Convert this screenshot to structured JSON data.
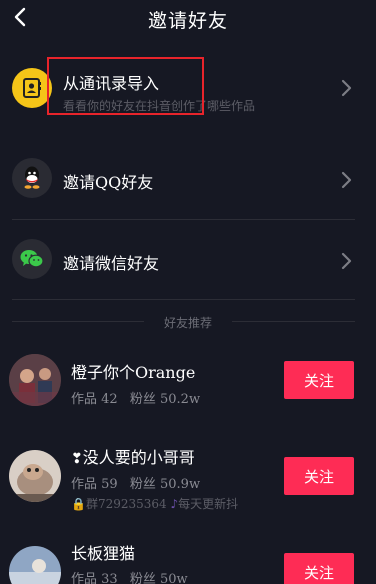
{
  "header": {
    "title": "邀请好友",
    "back_icon": "chevron-left-icon"
  },
  "options": [
    {
      "label": "从通讯录导入",
      "sub": "看看你的好友在抖音创作了哪些作品",
      "icon": "contacts-icon",
      "icon_color": "#f5c518"
    },
    {
      "label": "邀请QQ好友",
      "icon": "qq-icon",
      "icon_color": "#2a2b33"
    },
    {
      "label": "邀请微信好友",
      "icon": "wechat-icon",
      "icon_color": "#2a2b33"
    }
  ],
  "section": {
    "title": "好友推荐"
  },
  "friends": [
    {
      "name": "橙子你个Orange",
      "works_label": "作品",
      "works": "42",
      "fans_label": "粉丝",
      "fans": "50.2w",
      "follow": "关注"
    },
    {
      "name": "没人要的小哥哥",
      "works_label": "作品",
      "works": "59",
      "fans_label": "粉丝",
      "fans": "50.9w",
      "extra_a": "群729235364",
      "extra_b": "每天更新抖",
      "follow": "关注"
    },
    {
      "name": "长板狸猫",
      "works_label": "作品",
      "works": "33",
      "fans_label": "粉丝",
      "fans": "50w",
      "follow": "关注"
    }
  ],
  "colors": {
    "background": "#161823",
    "accent": "#fe2c55",
    "highlight_box": "#e8242b"
  }
}
